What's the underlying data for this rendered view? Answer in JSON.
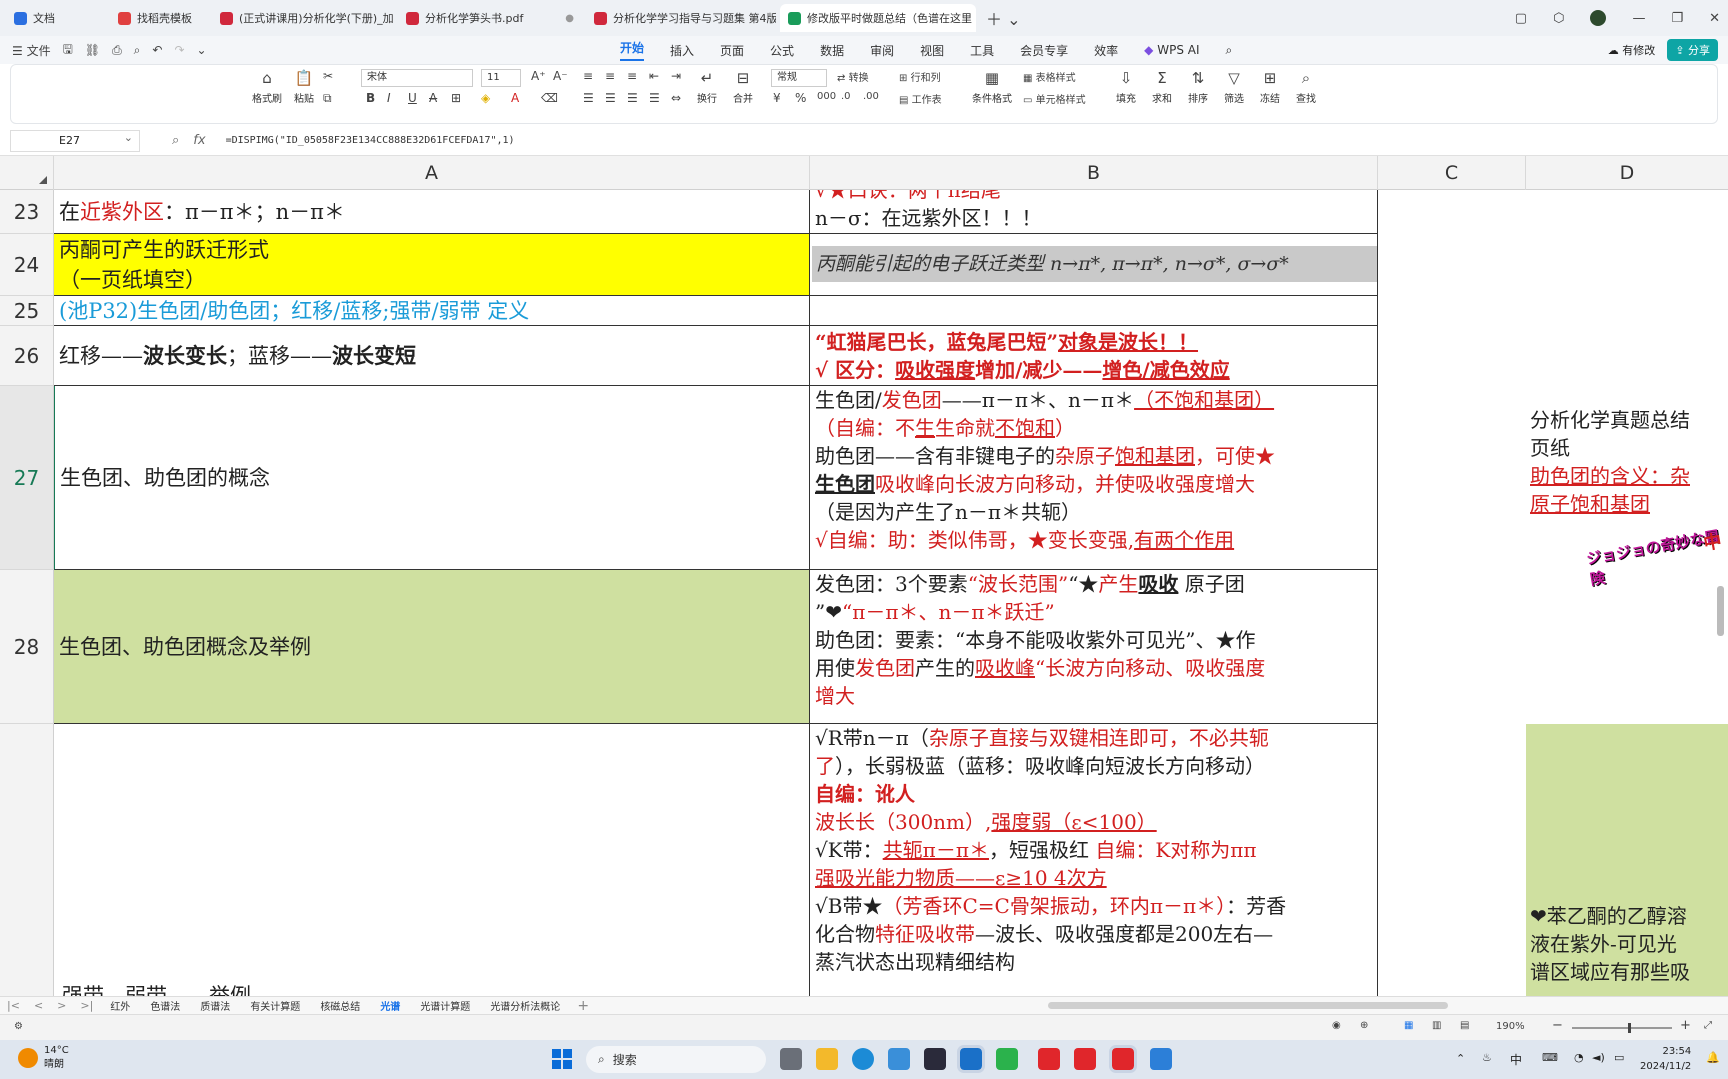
{
  "browser_tabs": [
    {
      "label": "文档",
      "color": "#2b6fe0",
      "active": false
    },
    {
      "label": "找稻壳模板",
      "color": "#e04040",
      "active": false
    },
    {
      "label": "(正式讲课用)分析化学(下册)_加",
      "color": "#d0283c",
      "active": false
    },
    {
      "label": "分析化学笋头书.pdf",
      "color": "#d0283c",
      "active": false
    },
    {
      "label": "分析化学学习指导与习题集 第4版.pdf",
      "color": "#d0283c",
      "active": false
    },
    {
      "label": "修改版平时做题总结（色谱在这里",
      "color": "#1a9c5a",
      "active": true
    }
  ],
  "menu": {
    "file": "文件",
    "tabs": [
      "开始",
      "插入",
      "页面",
      "公式",
      "数据",
      "审阅",
      "视图",
      "工具",
      "会员专享",
      "效率"
    ],
    "active_tab": "开始",
    "wps_ai": "WPS AI",
    "has_changes": "有修改",
    "share": "分享"
  },
  "ribbon": {
    "format_painter": "格式刷",
    "paste": "粘贴",
    "font_name": "宋体",
    "font_size": "11",
    "wrap": "换行",
    "merge": "合并",
    "number_format": "常规",
    "convert": "转换",
    "rows_cols": "行和列",
    "worksheet": "工作表",
    "table_style": "表格样式",
    "cell_style": "单元格样式",
    "cond_format": "条件格式",
    "fill": "填充",
    "sum": "求和",
    "sort": "排序",
    "filter": "筛选",
    "freeze": "冻结",
    "find": "查找"
  },
  "formula_bar": {
    "cell_ref": "E27",
    "formula": "=DISPIMG(\"ID_05058F23E134CC888E32D61FCEFDA17\",1)"
  },
  "columns": [
    "A",
    "B",
    "C",
    "D"
  ],
  "rows": {
    "r23": {
      "num": "23",
      "a_pre": "在",
      "a_red": "近紫外区",
      "a_post": "：π－π＊；n－π＊",
      "b_line1": "√★口诀：两个π结尾",
      "b_line2": "n－σ：在远紫外区！！！"
    },
    "r24": {
      "num": "24",
      "a_line1": "丙酮可产生的跃迁形式",
      "a_line2": "（一页纸填空）",
      "b_handwritten": "丙酮能引起的电子跃迁类型 n→π*, π→π*, n→σ*, σ→σ*"
    },
    "r25": {
      "num": "25",
      "a_text": "(池P32)生色团/助色团；红移/蓝移;强带/弱带 定义"
    },
    "r26": {
      "num": "26",
      "a_text1": "红移——",
      "a_text2": "波长变长",
      "a_text3": "；蓝移——",
      "a_text4": "波长变短",
      "b_line1a": "“虹猫尾巴长，蓝兔尾巴短”",
      "b_line1b": "对象是波长！！",
      "b_line2a": "√  区分：",
      "b_line2b": "吸收强度",
      "b_line2c": "增加/减少——",
      "b_line2d": "增色/减色效应"
    },
    "r27": {
      "num": "27",
      "a_text": "生色团、助色团的概念",
      "b_l1a": "生色团/",
      "b_l1b": "发色团",
      "b_l1c": "——π－π＊、n－π＊",
      "b_l1d": "（不饱和基团）",
      "b_l2a": "（自编：不",
      "b_l2b": "生",
      "b_l2c": "生命就",
      "b_l2d": "不饱和",
      "b_l2e": "）",
      "b_l3a": "助色团——含有非键电子的",
      "b_l3b": "杂原子",
      "b_l3c": "饱和基团",
      "b_l3d": "，可使★",
      "b_l4a": "生色团",
      "b_l4b": "吸收峰向长波方向移动，并使吸收强度增大",
      "b_l5": "（是因为产生了n－π＊共轭）",
      "b_l6a": "√自编：助：类似伟哥，★变长变强,",
      "b_l6b": "有两个作用"
    },
    "r28": {
      "num": "28",
      "a_text": "生色团、助色团概念及举例",
      "b_l1a": "发色团：3个要素",
      "b_l1b": "“波长范围”",
      "b_l1c": "“★",
      "b_l1d": "产生",
      "b_l1e": "吸收",
      "b_l1f": " 原子团",
      "b_l2a": "”❤",
      "b_l2b": "“π－π＊、n－π＊",
      "b_l2c": "跃迁”",
      "b_l3a": "助色团：要素：“本身不能吸收紫外可见光”、★作",
      "b_l4a": "用使",
      "b_l4b": "发色团",
      "b_l4c": "产生的",
      "b_l4d": "吸收峰",
      "b_l4e": "“长波方向移动、吸收强度",
      "b_l5": "增大"
    },
    "r29": {
      "a_partial": "强带、弱带……举例",
      "b_l1a": "√R带n－π（",
      "b_l1b": "杂原子直接与双键相连即可，不必共轭",
      "b_l2a": "了",
      "b_l2b": "），长弱极蓝（蓝移：吸收峰向短波长方向移动）",
      "b_l3": "自编：讹人",
      "b_l4a": "波长长（300nm）,",
      "b_l4b": "强度弱（ε<100）",
      "b_l5a": "√K带：",
      "b_l5b": "共轭π－π＊",
      "b_l5c": "，短强极红 ",
      "b_l5d": "自编：K对称为ππ",
      "b_l6": "强吸光能力物质——ε≥10 4次方",
      "b_l7a": "√B带★",
      "b_l7b": "（芳香环C=C骨架振动，环内π－π＊）",
      "b_l7c": "：芳香",
      "b_l8a": "化合物",
      "b_l8b": "特征吸收带",
      "b_l8c": "—波长、吸收强度都是200左右—",
      "b_l9": "蒸汽状态出现精细结构"
    },
    "d27": {
      "l1": "分析化学真题总结",
      "l2": "页纸",
      "l3": "助色团的含义：杂",
      "l4": "原子饱和基团"
    },
    "d29": {
      "l1": "❤苯乙酮的乙醇溶",
      "l2": "液在紫外-可见光",
      "l3": "谱区域应有那些吸"
    }
  },
  "sticker_text": "ジョジョの奇妙な冒険",
  "sticker_char": "中",
  "sheet_tabs": [
    "红外",
    "色谱法",
    "质谱法",
    "有关计算题",
    "核磁总结",
    "光谱",
    "光谱计算题",
    "光谱分析法概论"
  ],
  "active_sheet": "光谱",
  "status": {
    "zoom": "190%"
  },
  "taskbar": {
    "weather_temp": "14°C",
    "weather_desc": "晴朗",
    "search": "搜索",
    "ime": "中",
    "time": "23:54",
    "date": "2024/11/2"
  }
}
